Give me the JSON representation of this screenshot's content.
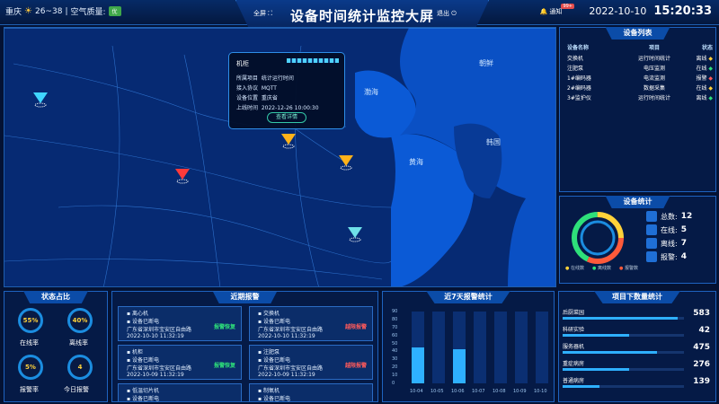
{
  "header": {
    "city": "重庆",
    "temp": "26~38",
    "aqi_label": "空气质量:",
    "aqi_value": "优",
    "title": "设备时间统计监控大屏",
    "fullscreen": "全屏",
    "exit": "退出",
    "notice": "通知",
    "notice_badge": "99+",
    "date": "2022-10-10",
    "time": "15:20:33"
  },
  "map": {
    "labels": {
      "bohai": "渤海",
      "huanghai": "黄海",
      "korea": "韩国",
      "chaoxian": "朝鲜"
    },
    "popup": {
      "title": "机柜",
      "rows": [
        {
          "k": "所属项目",
          "v": "统计运行时间"
        },
        {
          "k": "接入协议",
          "v": "MQTT"
        },
        {
          "k": "设备位置",
          "v": "重庆省"
        },
        {
          "k": "上线时间",
          "v": "2022-12-26 10:00:30"
        }
      ],
      "button": "查看详情"
    }
  },
  "device_list": {
    "title": "设备列表",
    "headers": [
      "设备名称",
      "项目",
      "状态"
    ],
    "rows": [
      {
        "name": "交换机",
        "project": "运行时间统计",
        "status": "离线",
        "color": "#ffd23a"
      },
      {
        "name": "注肥泵",
        "project": "电压监测",
        "status": "在线",
        "color": "#2ee07a"
      },
      {
        "name": "1#编码器",
        "project": "电流监测",
        "status": "报警",
        "color": "#ff5a5a"
      },
      {
        "name": "2#编码器",
        "project": "数据采集",
        "status": "在线",
        "color": "#ffd23a"
      },
      {
        "name": "3#监护仪",
        "project": "运行时间统计",
        "status": "离线",
        "color": "#2ee07a"
      }
    ]
  },
  "device_stats": {
    "title": "设备统计",
    "rows": [
      {
        "label": "总数:",
        "value": "12"
      },
      {
        "label": "在线:",
        "value": "5"
      },
      {
        "label": "离线:",
        "value": "7"
      },
      {
        "label": "报警:",
        "value": "4"
      }
    ],
    "legend": [
      "在线数",
      "离线数",
      "报警数"
    ]
  },
  "status_ratio": {
    "title": "状态占比",
    "gauges": [
      {
        "label": "在线率",
        "value": "55%"
      },
      {
        "label": "离线率",
        "value": "40%"
      },
      {
        "label": "报警率",
        "value": "5%"
      },
      {
        "label": "今日报警",
        "value": "4"
      }
    ]
  },
  "alarms": {
    "title": "近期报警",
    "items": [
      {
        "name": "离心机",
        "event": "设备已断电",
        "addr": "广东省深圳市宝安区自由路",
        "time": "2022-10-10 11:32:19",
        "tag": "报警恢复",
        "tagc": "#2ee07a"
      },
      {
        "name": "交换机",
        "event": "设备已断电",
        "addr": "广东省深圳市宝安区自由路",
        "time": "2022-10-10 11:32:19",
        "tag": "越限报警",
        "tagc": "#ff5a5a"
      },
      {
        "name": "机柜",
        "event": "设备已断电",
        "addr": "广东省深圳市宝安区自由路",
        "time": "2022-10-09 11:32:19",
        "tag": "报警恢复",
        "tagc": "#2ee07a"
      },
      {
        "name": "注肥泵",
        "event": "设备已断电",
        "addr": "广东省深圳市宝安区自由路",
        "time": "2022-10-09 11:32:19",
        "tag": "越限报警",
        "tagc": "#ff5a5a"
      },
      {
        "name": "低温切片机",
        "event": "设备已断电",
        "addr": "",
        "time": "",
        "tag": "",
        "tagc": "#2ee07a"
      },
      {
        "name": "制氧机",
        "event": "设备已断电",
        "addr": "",
        "time": "",
        "tag": "",
        "tagc": "#2ee07a"
      }
    ]
  },
  "chart_data": {
    "type": "bar",
    "title": "近7天报警统计",
    "categories": [
      "10-04",
      "10-05",
      "10-06",
      "10-07",
      "10-08",
      "10-09",
      "10-10"
    ],
    "values": [
      45,
      0,
      43,
      0,
      0,
      0,
      0
    ],
    "ylim": [
      0,
      90
    ],
    "yticks": [
      0,
      10,
      20,
      30,
      40,
      50,
      60,
      70,
      80,
      90
    ]
  },
  "project_count": {
    "title": "项目下数量统计",
    "rows": [
      {
        "name": "后厨菜园",
        "value": "583"
      },
      {
        "name": "科研实验",
        "value": "42"
      },
      {
        "name": "服务器机",
        "value": "475"
      },
      {
        "name": "重症病房",
        "value": "276"
      },
      {
        "name": "普通病房",
        "value": "139"
      }
    ],
    "fractions": [
      0.95,
      0.55,
      0.78,
      0.55,
      0.3
    ]
  }
}
